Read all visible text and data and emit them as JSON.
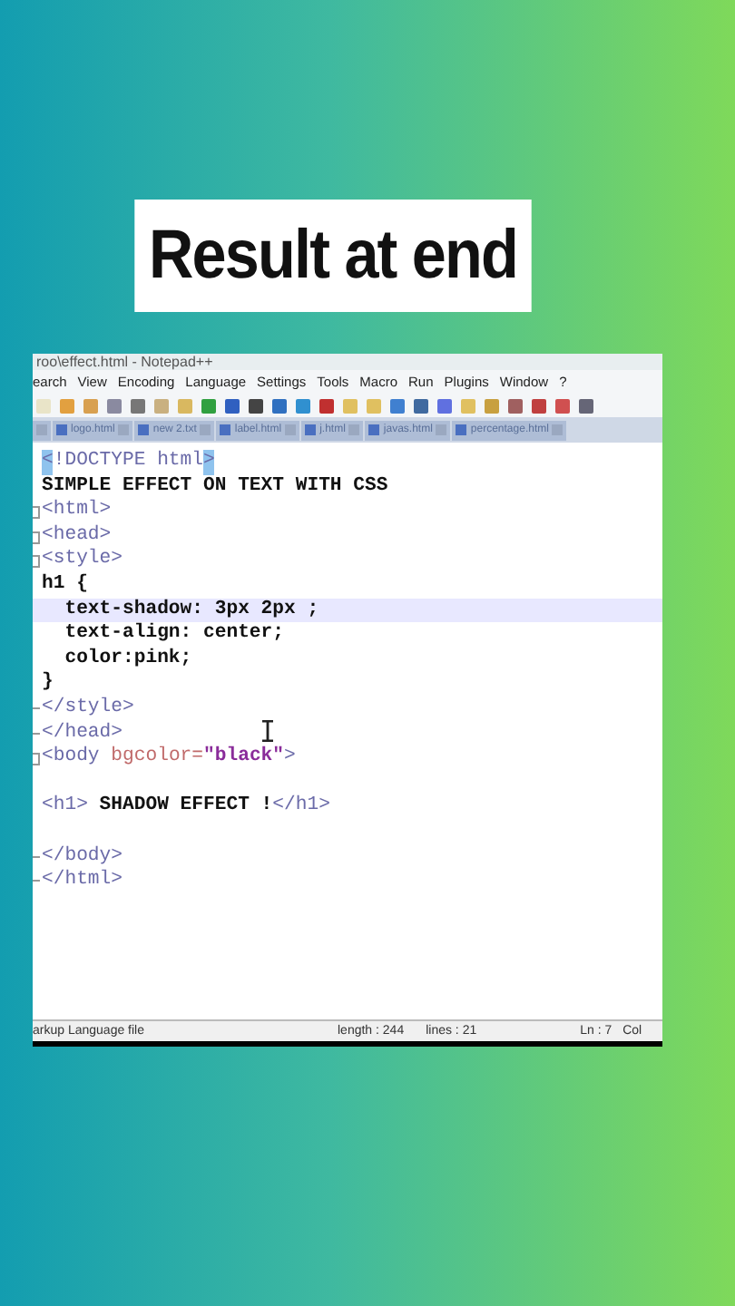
{
  "caption": "Result at end",
  "window": {
    "title": "roo\\effect.html - Notepad++"
  },
  "menu": [
    "earch",
    "View",
    "Encoding",
    "Language",
    "Settings",
    "Tools",
    "Macro",
    "Run",
    "Plugins",
    "Window",
    "?"
  ],
  "tabs": [
    {
      "selected": false
    },
    {
      "label": "logo.html",
      "selected": false
    },
    {
      "label": "new 2.txt",
      "selected": false
    },
    {
      "label": "label.html",
      "selected": false
    },
    {
      "label": "j.html",
      "selected": false
    },
    {
      "label": "javas.html",
      "selected": false
    },
    {
      "label": "percentage.html",
      "selected": false
    }
  ],
  "editor": {
    "lines": [
      {
        "kind": "plain",
        "selected": false,
        "segments": [
          {
            "kind": "match",
            "text": "<"
          },
          {
            "kind": "tag",
            "text": "!DOCTYPE html"
          },
          {
            "kind": "match",
            "text": ">"
          }
        ]
      },
      {
        "kind": "plain",
        "selected": false,
        "segments": [
          {
            "kind": "text",
            "text": "SIMPLE EFFECT ON TEXT WITH CSS"
          }
        ]
      },
      {
        "kind": "foldstart",
        "selected": false,
        "segments": [
          {
            "kind": "tag",
            "text": "<html>"
          }
        ]
      },
      {
        "kind": "foldstart",
        "selected": false,
        "segments": [
          {
            "kind": "tag",
            "text": "<head>"
          }
        ]
      },
      {
        "kind": "foldstart",
        "selected": false,
        "segments": [
          {
            "kind": "tag",
            "text": "<style>"
          }
        ]
      },
      {
        "kind": "plain",
        "selected": false,
        "segments": [
          {
            "kind": "text",
            "text": "h1 {"
          }
        ]
      },
      {
        "kind": "plain",
        "selected": true,
        "segments": [
          {
            "kind": "text",
            "text": "  text-shadow: 3px 2px ;"
          }
        ]
      },
      {
        "kind": "plain",
        "selected": false,
        "segments": [
          {
            "kind": "text",
            "text": "  text-align: center;"
          }
        ]
      },
      {
        "kind": "plain",
        "selected": false,
        "segments": [
          {
            "kind": "text",
            "text": "  color:pink;"
          }
        ]
      },
      {
        "kind": "plain",
        "selected": false,
        "segments": [
          {
            "kind": "text",
            "text": "}"
          }
        ]
      },
      {
        "kind": "foldend",
        "selected": false,
        "segments": [
          {
            "kind": "tag",
            "text": "</style>"
          }
        ]
      },
      {
        "kind": "foldend",
        "selected": false,
        "segments": [
          {
            "kind": "tag",
            "text": "</head>"
          }
        ]
      },
      {
        "kind": "foldstart",
        "selected": false,
        "segments": [
          {
            "kind": "tag",
            "text": "<body "
          },
          {
            "kind": "attr",
            "text": "bgcolor="
          },
          {
            "kind": "string",
            "text": "\"black\""
          },
          {
            "kind": "tag",
            "text": ">"
          }
        ]
      },
      {
        "kind": "plain",
        "selected": false
      },
      {
        "kind": "plain",
        "selected": false,
        "segments": [
          {
            "kind": "tag",
            "text": "<h1> "
          },
          {
            "kind": "text",
            "text": "SHADOW EFFECT !"
          },
          {
            "kind": "tag",
            "text": "</h1>"
          }
        ]
      },
      {
        "kind": "plain",
        "selected": false
      },
      {
        "kind": "foldend",
        "selected": false,
        "segments": [
          {
            "kind": "tag",
            "text": "</body>"
          }
        ]
      },
      {
        "kind": "foldend",
        "selected": false,
        "segments": [
          {
            "kind": "tag",
            "text": "</html>"
          }
        ]
      }
    ]
  },
  "status_bar": {
    "file_type": "arkup Language file",
    "length": "length : 244",
    "lines": "lines : 21",
    "position": "Ln : 7",
    "column": "Col"
  }
}
